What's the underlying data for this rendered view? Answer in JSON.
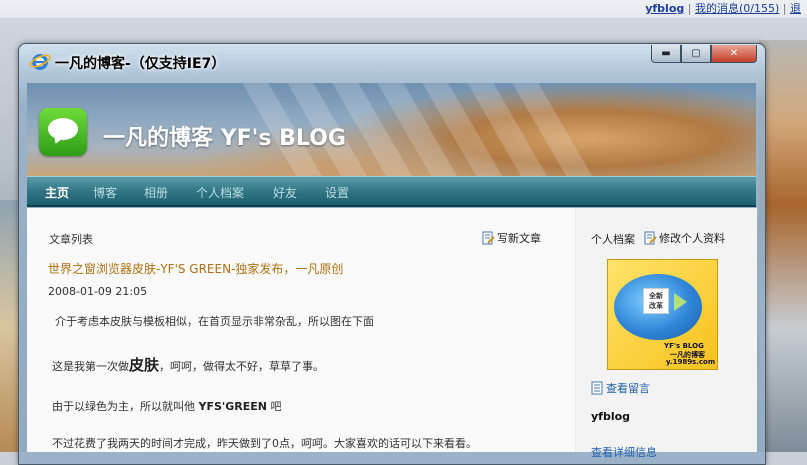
{
  "top_links": {
    "username": "yfblog",
    "messages": "我的消息(0/155)",
    "separator": "|",
    "truncated": "退"
  },
  "window": {
    "title": "一凡的博客-（仅支持IE7）",
    "min_symbol": "▬",
    "max_symbol": "▢",
    "close_symbol": "✕"
  },
  "banner": {
    "title": "一凡的博客 YF's BLOG"
  },
  "nav": {
    "items": [
      "主页",
      "博客",
      "相册",
      "个人档案",
      "好友",
      "设置"
    ],
    "active_index": 0
  },
  "main": {
    "section_label": "文章列表",
    "write_link": "写新文章",
    "article": {
      "title": "世界之窗浏览器皮肤-YF'S GREEN-独家发布，一凡原创",
      "date": "2008-01-09 21:05",
      "para1": "介于考虑本皮肤与模板相似，在首页显示非常杂乱，所以图在下面",
      "para2_pre": "这是我第一次做",
      "para2_big": "皮肤",
      "para2_post": "，呵呵，做得太不好，草草了事。",
      "para3_pre": "由于以绿色为主，所以就叫他 ",
      "para3_bold": "YFS'GREEN",
      "para3_post": " 吧",
      "para4": "不过花费了我两天的时间才完成，昨天做到了0点，呵呵。大家喜欢的话可以下来看看。"
    }
  },
  "sidebar": {
    "label": "个人档案",
    "edit_link": "修改个人资料",
    "avatar": {
      "badge_line1": "全新",
      "badge_line2": "改革",
      "line1": "YF's BLOG",
      "line2": "一凡的博客",
      "line3": "y.1989s.com"
    },
    "view_messages": "查看留言",
    "username": "yfblog",
    "more_info": "查看详细信息"
  },
  "colors": {
    "accent": "#2f7483",
    "link": "#1f5fb0",
    "article_title": "#b07010"
  }
}
